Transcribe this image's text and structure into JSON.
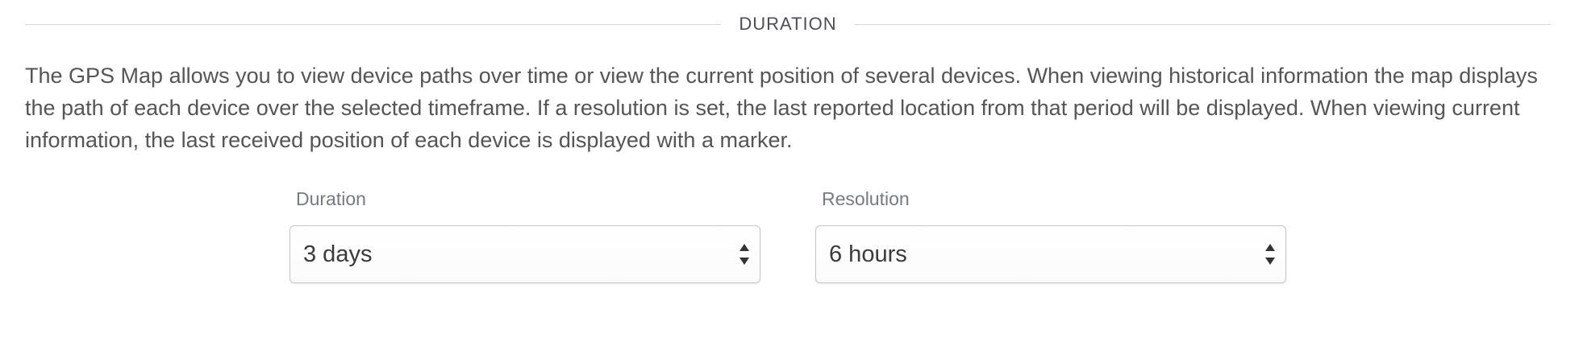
{
  "section": {
    "title": "DURATION"
  },
  "description": "The GPS Map allows you to view device paths over time or view the current position of several devices. When viewing historical information the map displays the path of each device over the selected timeframe. If a resolution is set, the last reported location from that period will be displayed. When viewing current information, the last received position of each device is displayed with a marker.",
  "fields": {
    "duration": {
      "label": "Duration",
      "value": "3 days"
    },
    "resolution": {
      "label": "Resolution",
      "value": "6 hours"
    }
  },
  "icons": {
    "select_arrow": "up-down-caret-icon"
  },
  "colors": {
    "border": "#c3c6cb",
    "text": "#555555",
    "label": "#777a80"
  }
}
